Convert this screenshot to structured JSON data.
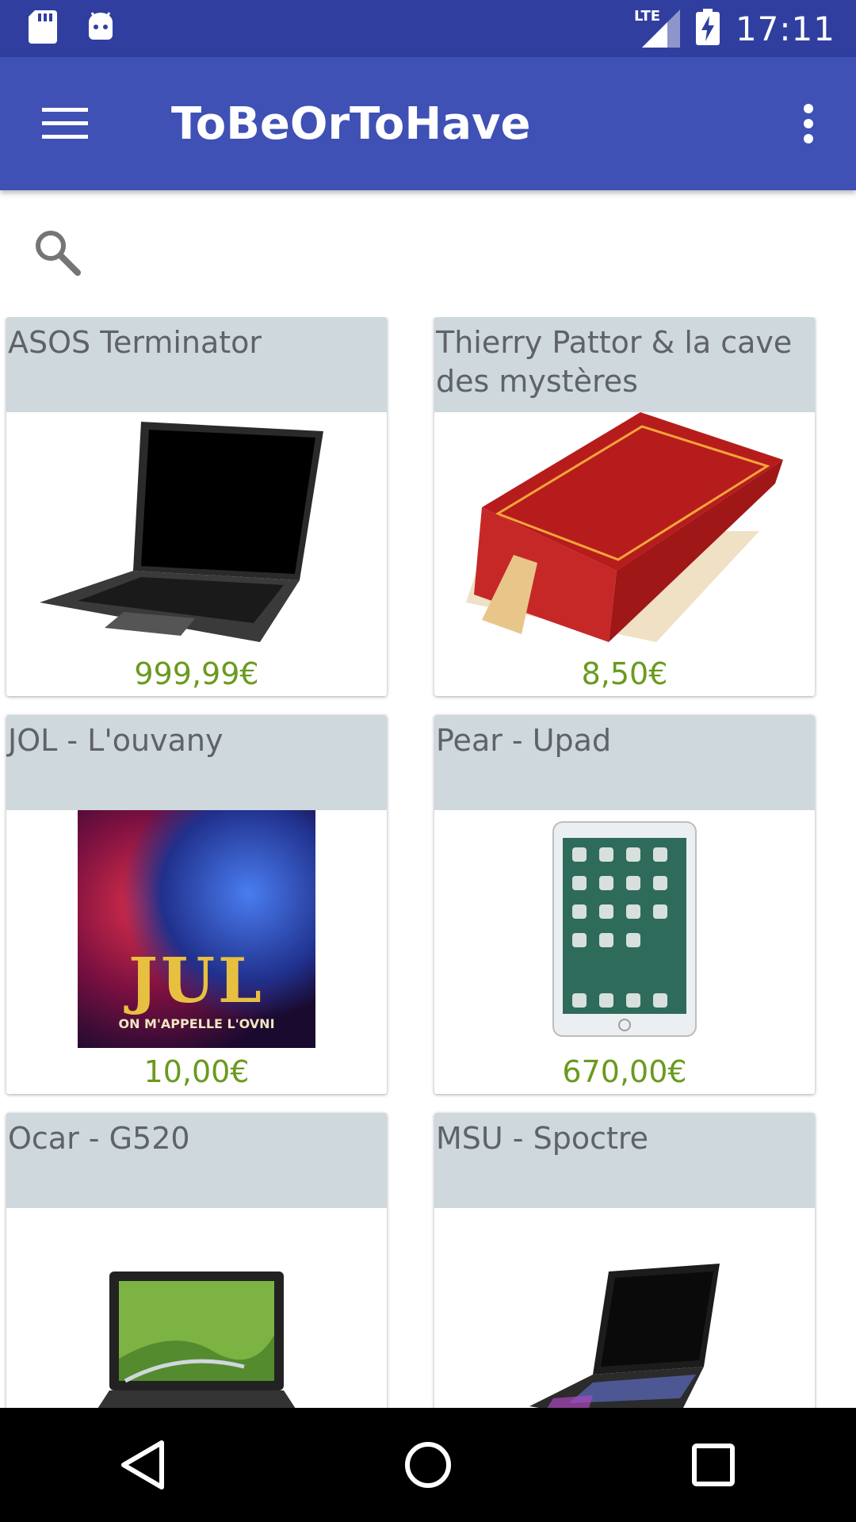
{
  "status_bar": {
    "time": "17:11",
    "network_label": "LTE",
    "left_icons": [
      "sd-card-icon",
      "android-debug-icon"
    ],
    "right_icons": [
      "signal-icon",
      "battery-charging-icon"
    ]
  },
  "app_bar": {
    "title": "ToBeOrToHave",
    "menu_icon": "hamburger-menu-icon",
    "overflow_icon": "more-vert-icon"
  },
  "search": {
    "icon": "search-icon",
    "placeholder": ""
  },
  "products": [
    {
      "title": "ASOS Terminator",
      "price": "999,99€",
      "image": "laptop-black"
    },
    {
      "title": "Thierry Pattor & la cave des mystères",
      "price": "8,50€",
      "image": "red-book"
    },
    {
      "title": "JOL - L'ouvany",
      "price": "10,00€",
      "image": "album-cover"
    },
    {
      "title": "Pear - Upad",
      "price": "670,00€",
      "image": "tablet"
    },
    {
      "title": "Ocar - G520",
      "price": "",
      "image": "laptop-convertible"
    },
    {
      "title": "MSU - Spoctre",
      "price": "",
      "image": "gaming-laptop"
    }
  ],
  "album_cover_text": {
    "main": "JUL",
    "sub": "ON M'APPELLE L'OVNI"
  },
  "colors": {
    "status_bar": "#303f9f",
    "app_bar": "#3f51b5",
    "card_header": "#cfd8dc",
    "price": "#6a9a1f"
  },
  "nav_bar": {
    "buttons": [
      "back-icon",
      "home-icon",
      "recents-icon"
    ]
  }
}
